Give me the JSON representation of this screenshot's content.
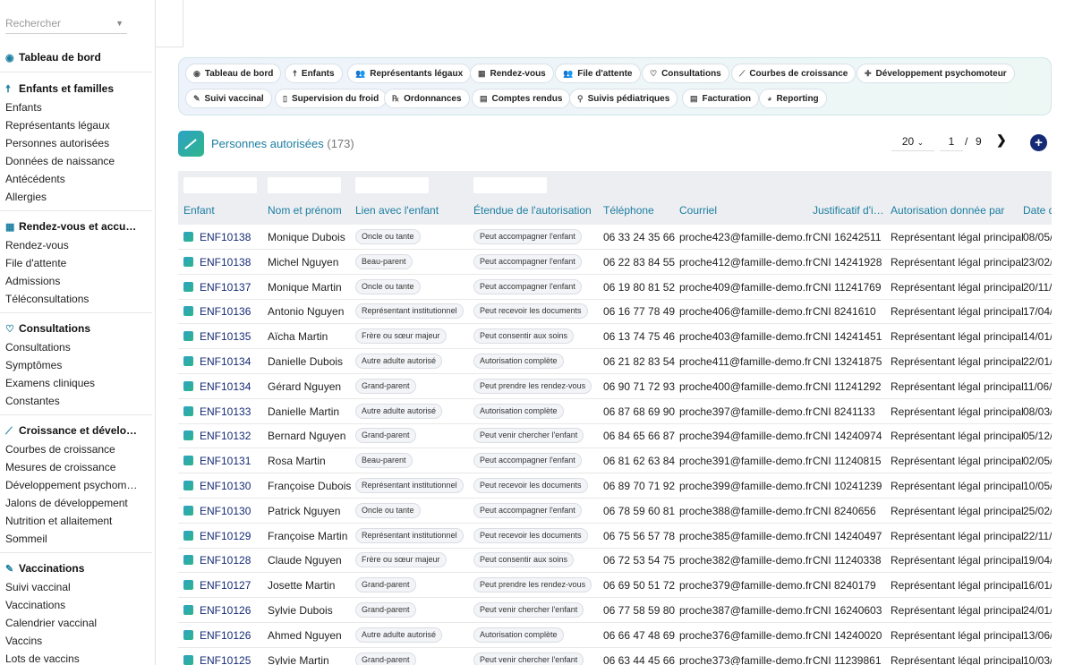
{
  "search": {
    "placeholder": "Rechercher"
  },
  "sidebar": {
    "dashboard": {
      "label": "Tableau de bord"
    },
    "sections": [
      {
        "label": "Enfants et familles",
        "items": [
          "Enfants",
          "Représentants légaux",
          "Personnes autorisées",
          "Données de naissance",
          "Antécédents",
          "Allergies"
        ]
      },
      {
        "label": "Rendez-vous et accu…",
        "items": [
          "Rendez-vous",
          "File d'attente",
          "Admissions",
          "Téléconsultations"
        ]
      },
      {
        "label": "Consultations",
        "items": [
          "Consultations",
          "Symptômes",
          "Examens cliniques",
          "Constantes"
        ]
      },
      {
        "label": "Croissance et dévelo…",
        "items": [
          "Courbes de croissance",
          "Mesures de croissance",
          "Développement psychom…",
          "Jalons de développement",
          "Nutrition et allaitement",
          "Sommeil"
        ]
      },
      {
        "label": "Vaccinations",
        "items": [
          "Suivi vaccinal",
          "Vaccinations",
          "Calendrier vaccinal",
          "Vaccins",
          "Lots de vaccins"
        ]
      }
    ]
  },
  "nav": {
    "row1": [
      "Tableau de bord",
      "Enfants",
      "Représentants légaux",
      "Rendez-vous",
      "File d'attente",
      "Consultations",
      "Courbes de croissance",
      "Développement psychomoteur"
    ],
    "row2": [
      "Suivi vaccinal",
      "Supervision du froid",
      "Ordonnances",
      "Comptes rendus",
      "Suivis pédiatriques",
      "Facturation",
      "Reporting"
    ]
  },
  "page": {
    "title": "Personnes autorisées",
    "count": "(173)"
  },
  "pagination": {
    "per_page": "20",
    "current": "1",
    "sep": "/",
    "total": "9"
  },
  "table": {
    "headers": [
      "Enfant",
      "Nom et prénom",
      "Lien avec l'enfant",
      "Étendue de l'autorisation",
      "Téléphone",
      "Courriel",
      "Justificatif d'i…",
      "Autorisation donnée par",
      "Date d"
    ],
    "rows": [
      [
        "ENF10138",
        "Monique Dubois",
        "Oncle ou tante",
        "Peut accompagner l'enfant",
        "06 33 24 35 66",
        "proche423@famille-demo.fr",
        "CNI 16242511",
        "Représentant légal principal",
        "08/05/"
      ],
      [
        "ENF10138",
        "Michel Nguyen",
        "Beau-parent",
        "Peut accompagner l'enfant",
        "06 22 83 84 55",
        "proche412@famille-demo.fr",
        "CNI 14241928",
        "Représentant légal principal",
        "23/02/"
      ],
      [
        "ENF10137",
        "Monique Martin",
        "Oncle ou tante",
        "Peut accompagner l'enfant",
        "06 19 80 81 52",
        "proche409@famille-demo.fr",
        "CNI 11241769",
        "Représentant légal principal",
        "20/11/"
      ],
      [
        "ENF10136",
        "Antonio Nguyen",
        "Représentant institutionnel",
        "Peut recevoir les documents",
        "06 16 77 78 49",
        "proche406@famille-demo.fr",
        "CNI 8241610",
        "Représentant légal principal",
        "17/04/"
      ],
      [
        "ENF10135",
        "Aïcha Martin",
        "Frère ou sœur majeur",
        "Peut consentir aux soins",
        "06 13 74 75 46",
        "proche403@famille-demo.fr",
        "CNI 14241451",
        "Représentant légal principal",
        "14/01/"
      ],
      [
        "ENF10134",
        "Danielle Dubois",
        "Autre adulte autorisé",
        "Autorisation complète",
        "06 21 82 83 54",
        "proche411@famille-demo.fr",
        "CNI 13241875",
        "Représentant légal principal",
        "22/01/"
      ],
      [
        "ENF10134",
        "Gérard Nguyen",
        "Grand-parent",
        "Peut prendre les rendez-vous",
        "06 90 71 72 93",
        "proche400@famille-demo.fr",
        "CNI 11241292",
        "Représentant légal principal",
        "11/06/"
      ],
      [
        "ENF10133",
        "Danielle Martin",
        "Autre adulte autorisé",
        "Autorisation complète",
        "06 87 68 69 90",
        "proche397@famille-demo.fr",
        "CNI 8241133",
        "Représentant légal principal",
        "08/03/"
      ],
      [
        "ENF10132",
        "Bernard Nguyen",
        "Grand-parent",
        "Peut venir chercher l'enfant",
        "06 84 65 66 87",
        "proche394@famille-demo.fr",
        "CNI 14240974",
        "Représentant légal principal",
        "05/12/"
      ],
      [
        "ENF10131",
        "Rosa Martin",
        "Beau-parent",
        "Peut accompagner l'enfant",
        "06 81 62 63 84",
        "proche391@famille-demo.fr",
        "CNI 11240815",
        "Représentant légal principal",
        "02/05/"
      ],
      [
        "ENF10130",
        "Françoise Dubois",
        "Représentant institutionnel",
        "Peut recevoir les documents",
        "06 89 70 71 92",
        "proche399@famille-demo.fr",
        "CNI 10241239",
        "Représentant légal principal",
        "10/05/"
      ],
      [
        "ENF10130",
        "Patrick Nguyen",
        "Oncle ou tante",
        "Peut accompagner l'enfant",
        "06 78 59 60 81",
        "proche388@famille-demo.fr",
        "CNI 8240656",
        "Représentant légal principal",
        "25/02/"
      ],
      [
        "ENF10129",
        "Françoise Martin",
        "Représentant institutionnel",
        "Peut recevoir les documents",
        "06 75 56 57 78",
        "proche385@famille-demo.fr",
        "CNI 14240497",
        "Représentant légal principal",
        "22/11/"
      ],
      [
        "ENF10128",
        "Claude Nguyen",
        "Frère ou sœur majeur",
        "Peut consentir aux soins",
        "06 72 53 54 75",
        "proche382@famille-demo.fr",
        "CNI 11240338",
        "Représentant légal principal",
        "19/04/"
      ],
      [
        "ENF10127",
        "Josette Martin",
        "Grand-parent",
        "Peut prendre les rendez-vous",
        "06 69 50 51 72",
        "proche379@famille-demo.fr",
        "CNI 8240179",
        "Représentant légal principal",
        "16/01/"
      ],
      [
        "ENF10126",
        "Sylvie Dubois",
        "Grand-parent",
        "Peut venir chercher l'enfant",
        "06 77 58 59 80",
        "proche387@famille-demo.fr",
        "CNI 16240603",
        "Représentant légal principal",
        "24/01/"
      ],
      [
        "ENF10126",
        "Ahmed Nguyen",
        "Autre adulte autorisé",
        "Autorisation complète",
        "06 66 47 48 69",
        "proche376@famille-demo.fr",
        "CNI 14240020",
        "Représentant légal principal",
        "13/06/"
      ],
      [
        "ENF10125",
        "Sylvie Martin",
        "Grand-parent",
        "Peut venir chercher l'enfant",
        "06 63 44 45 66",
        "proche373@famille-demo.fr",
        "CNI 11239861",
        "Représentant légal principal",
        "10/03/"
      ]
    ]
  },
  "colors": {
    "accent": "#1c7ea0",
    "link": "#152a75",
    "add": "#152a75"
  }
}
